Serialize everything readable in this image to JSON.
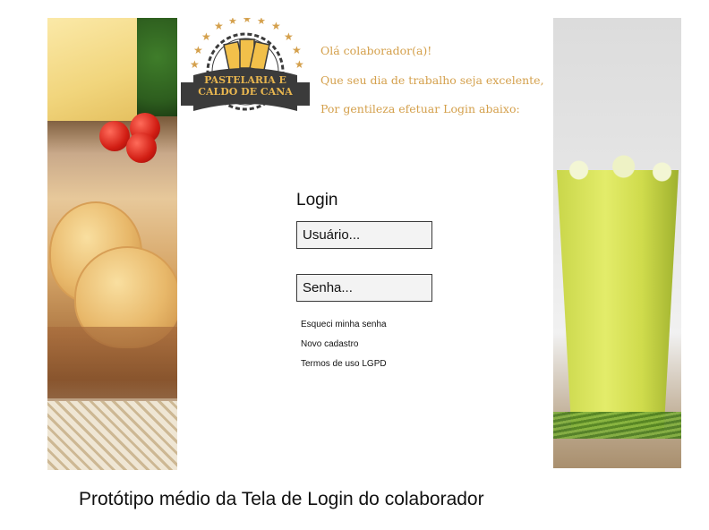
{
  "logo": {
    "line1": "PASTELARIA E",
    "line2": "CALDO DE CANA"
  },
  "greeting": {
    "line1": "Olá colaborador(a)!",
    "line2": "Que seu dia de trabalho seja excelente,",
    "line3": "Por gentileza efetuar Login abaixo:"
  },
  "login": {
    "title": "Login",
    "username_placeholder": "Usuário...",
    "password_placeholder": "Senha..."
  },
  "links": {
    "forgot": "Esqueci minha senha",
    "register": "Novo cadastro",
    "terms": "Termos de uso LGPD"
  },
  "caption": "Protótipo médio da Tela de Login do colaborador",
  "colors": {
    "accent_gold": "#d4a04c",
    "logo_dark": "#3b3b3b"
  }
}
